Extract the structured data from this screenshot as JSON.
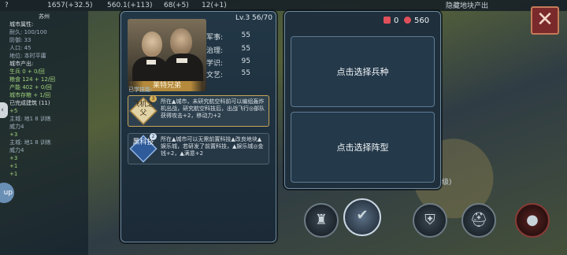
{
  "topbar": {
    "nav_icon": "?",
    "gold": "1657(+32.5)",
    "science": "560.1(+113)",
    "culture": "68(+5)",
    "happiness": "12(+1)",
    "hide_hint": "隐藏地块产出"
  },
  "left_panel": {
    "city_name": "苏州",
    "rows": [
      {
        "text": "城市属性:",
        "style": "lp-head"
      },
      {
        "text": "耐久: 100/100",
        "style": ""
      },
      {
        "text": "防御: 33",
        "style": ""
      },
      {
        "text": "人口: 45",
        "style": ""
      },
      {
        "text": "地位: 本时平庸",
        "style": ""
      },
      {
        "text": "城市产出:",
        "style": "lp-head"
      },
      {
        "text": "生兵 0 + 0/回",
        "style": "lp-green"
      },
      {
        "text": "粮食 124 + 12/回",
        "style": "lp-green"
      },
      {
        "text": "产能 402 + 0/回",
        "style": "lp-green"
      },
      {
        "text": "城市存粮 + 1/回",
        "style": "lp-green"
      },
      {
        "text": "已完成建筑 (11)",
        "style": "lp-head"
      },
      {
        "text": "+5",
        "style": "lp-green"
      },
      {
        "text": "主城: 地1 8 训练",
        "style": ""
      },
      {
        "text": "威力4",
        "style": ""
      },
      {
        "text": "+3",
        "style": "lp-green"
      },
      {
        "text": "主城: 地1 8 训练",
        "style": ""
      },
      {
        "text": "威力4",
        "style": ""
      },
      {
        "text": "+3",
        "style": "lp-green"
      },
      {
        "text": "+1",
        "style": "lp-green"
      },
      {
        "text": "+1",
        "style": "lp-green"
      }
    ],
    "bubble": "up"
  },
  "hero": {
    "name": "莱特兄弟",
    "level": "Lv.3 56/70",
    "stats": [
      {
        "label": "军事:",
        "value": "55"
      },
      {
        "label": "治理:",
        "value": "55"
      },
      {
        "label": "学识:",
        "value": "95"
      },
      {
        "label": "文艺:",
        "value": "55"
      }
    ],
    "skills_label": "已学技能:",
    "skills": [
      {
        "name": "飞机之父",
        "level": "3",
        "desc": "所在▲城市，未研究航空科前可以编组轰炸机出战，研究航空科技后，出战飞行◎部队获得攻击+2，移动力+2"
      },
      {
        "name": "黑科技",
        "level": "2",
        "desc": "所在▲城市可以无需前置科技▲改良地块▲娱乐城，若研发了前置科技，▲娱乐城◎金钱+2，▲满意+2"
      }
    ]
  },
  "selection": {
    "resource_a": "0",
    "resource_b": "560",
    "choose_unit": "点击选择兵种",
    "choose_formation": "点击选择阵型",
    "side_fragment": "级)"
  },
  "close_label": "✕",
  "bottom_buttons": [
    {
      "name": "castle-button",
      "icon": "♜"
    },
    {
      "name": "confirm-button",
      "icon": "✔"
    },
    {
      "name": "shield-button",
      "icon": "⛨"
    },
    {
      "name": "helmet-button",
      "icon": "⛑"
    },
    {
      "name": "red-button",
      "icon": "●"
    }
  ],
  "colors": {
    "panel_bg": "#1f2f3c",
    "panel_border": "#6d8aa0",
    "gold_accent": "#c9a65a",
    "resource_red": "#e0505a"
  }
}
